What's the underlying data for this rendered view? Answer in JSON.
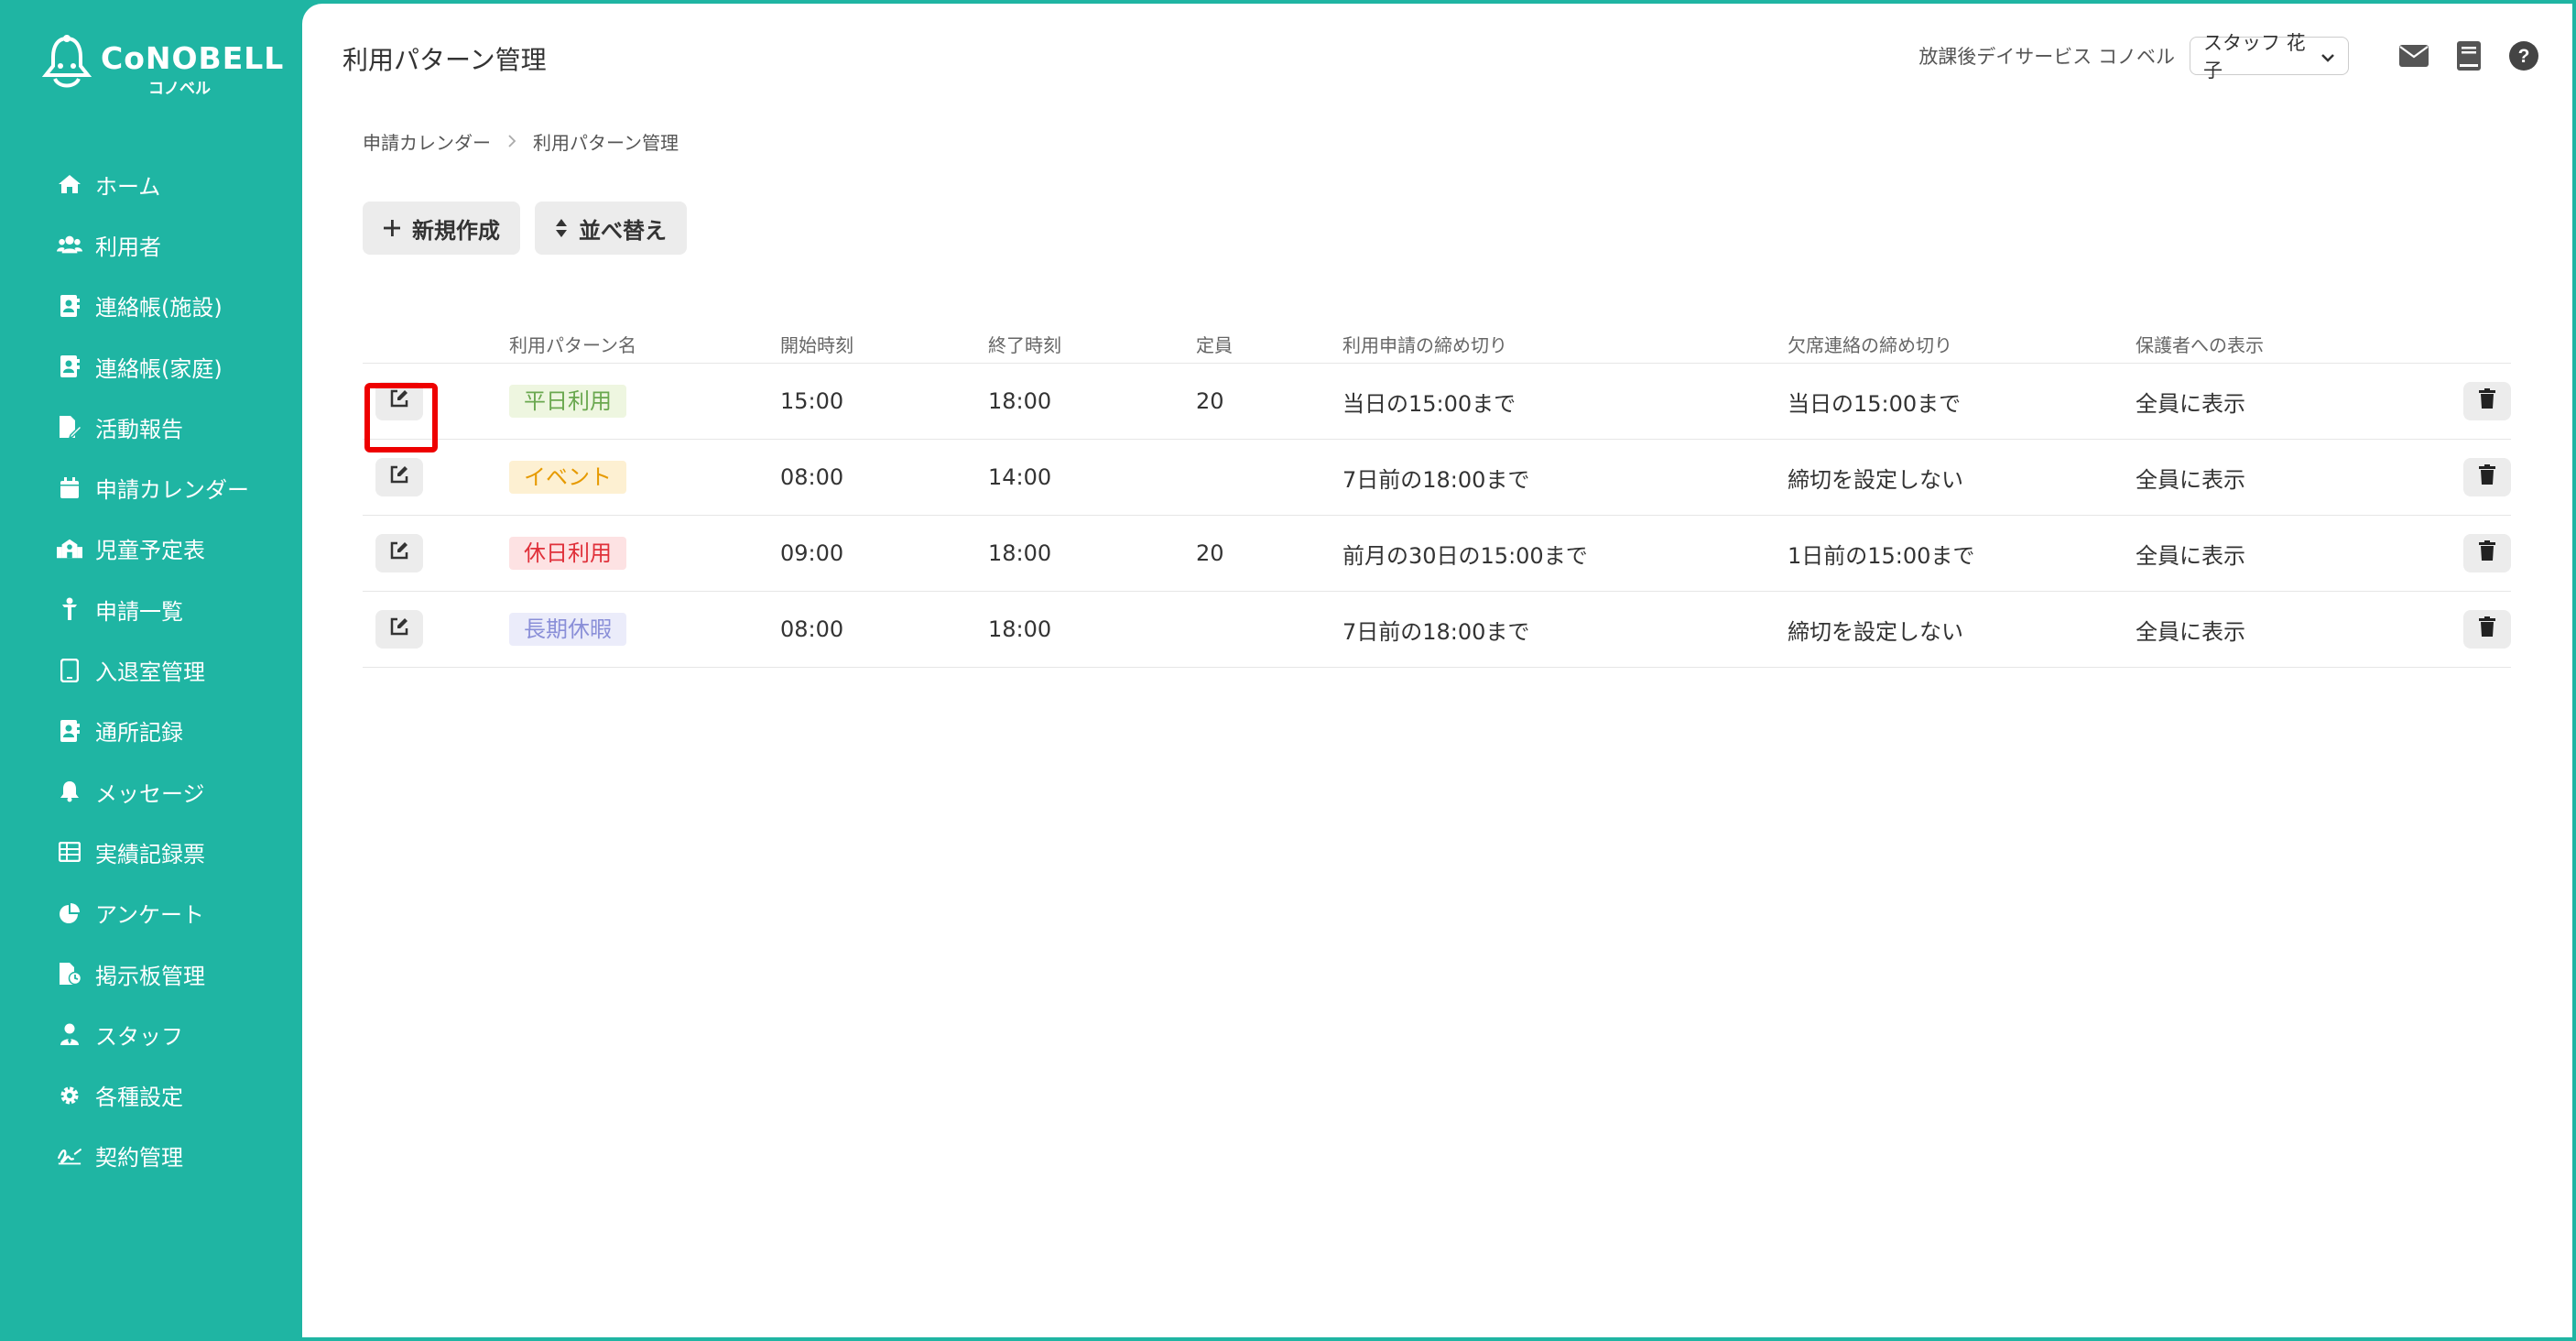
{
  "app": {
    "logo_text": "CoNOBELL",
    "logo_sub": "コノベル"
  },
  "sidebar": {
    "items": [
      {
        "label": "ホーム",
        "icon": "home-icon"
      },
      {
        "label": "利用者",
        "icon": "users-icon"
      },
      {
        "label": "連絡帳(施設)",
        "icon": "contact-book-icon"
      },
      {
        "label": "連絡帳(家庭)",
        "icon": "contact-book-icon"
      },
      {
        "label": "活動報告",
        "icon": "file-edit-icon"
      },
      {
        "label": "申請カレンダー",
        "icon": "calendar-icon"
      },
      {
        "label": "児童予定表",
        "icon": "school-icon"
      },
      {
        "label": "申請一覧",
        "icon": "child-icon"
      },
      {
        "label": "入退室管理",
        "icon": "tablet-icon"
      },
      {
        "label": "通所記録",
        "icon": "contact-book-icon"
      },
      {
        "label": "メッセージ",
        "icon": "bell-icon"
      },
      {
        "label": "実績記録票",
        "icon": "table-icon"
      },
      {
        "label": "アンケート",
        "icon": "pie-chart-icon"
      },
      {
        "label": "掲示板管理",
        "icon": "file-clock-icon"
      },
      {
        "label": "スタッフ",
        "icon": "staff-icon"
      },
      {
        "label": "各種設定",
        "icon": "gear-icon"
      },
      {
        "label": "契約管理",
        "icon": "signature-icon"
      }
    ]
  },
  "header": {
    "title": "利用パターン管理",
    "facility": "放課後デイサービス コノベル",
    "user": "スタッフ 花子"
  },
  "breadcrumb": {
    "parent": "申請カレンダー",
    "current": "利用パターン管理"
  },
  "actions": {
    "new_label": "新規作成",
    "sort_label": "並べ替え"
  },
  "table": {
    "headers": {
      "name": "利用パターン名",
      "start": "開始時刻",
      "end": "終了時刻",
      "capacity": "定員",
      "apply_deadline": "利用申請の締め切り",
      "absence_deadline": "欠席連絡の締め切り",
      "guardian_display": "保護者への表示"
    },
    "rows": [
      {
        "name": "平日利用",
        "name_color": "#6aa84f",
        "name_bg": "#eef6e0",
        "start": "15:00",
        "end": "18:00",
        "capacity": "20",
        "apply_deadline": "当日の15:00まで",
        "absence_deadline": "当日の15:00まで",
        "guardian_display": "全員に表示"
      },
      {
        "name": "イベント",
        "name_color": "#e69a00",
        "name_bg": "#fdf0d2",
        "start": "08:00",
        "end": "14:00",
        "capacity": "",
        "apply_deadline": "7日前の18:00まで",
        "absence_deadline": "締切を設定しない",
        "guardian_display": "全員に表示"
      },
      {
        "name": "休日利用",
        "name_color": "#e0303a",
        "name_bg": "#fde2e3",
        "start": "09:00",
        "end": "18:00",
        "capacity": "20",
        "apply_deadline": "前月の30日の15:00まで",
        "absence_deadline": "1日前の15:00まで",
        "guardian_display": "全員に表示"
      },
      {
        "name": "長期休暇",
        "name_color": "#8a8fd8",
        "name_bg": "#ebecfa",
        "start": "08:00",
        "end": "18:00",
        "capacity": "",
        "apply_deadline": "7日前の18:00まで",
        "absence_deadline": "締切を設定しない",
        "guardian_display": "全員に表示"
      }
    ]
  },
  "colors": {
    "brand": "#1fb5a3",
    "highlight": "#e00000"
  }
}
